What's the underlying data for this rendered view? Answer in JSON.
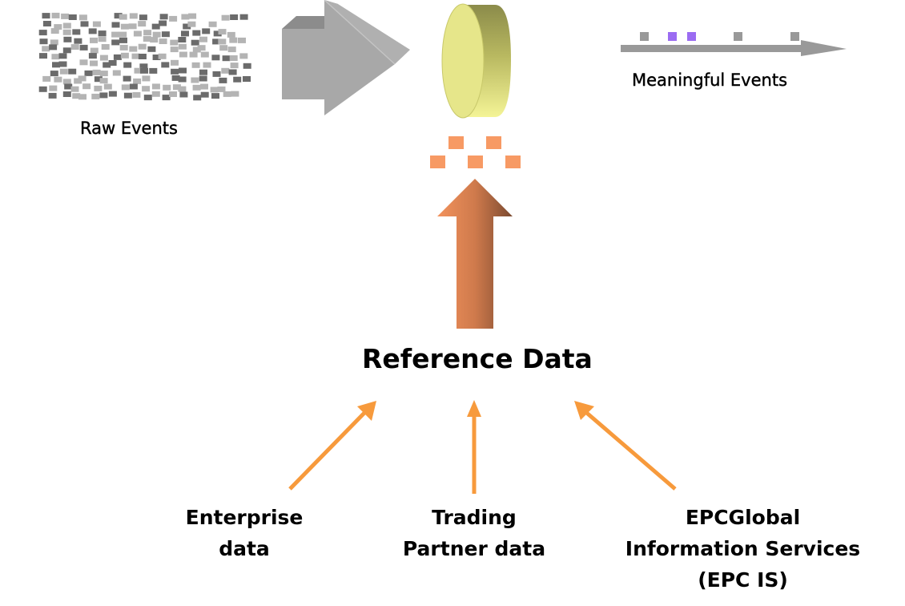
{
  "diagram": {
    "raw_events_label": "Raw Events",
    "meaningful_events_label": "Meaningful Events",
    "reference_data_label": "Reference Data",
    "sources": [
      {
        "line1": "Enterprise",
        "line2": "data",
        "line3": ""
      },
      {
        "line1": "Trading",
        "line2": "Partner data",
        "line3": ""
      },
      {
        "line1": "EPCGlobal",
        "line2": "Information Services",
        "line3": "(EPC IS)"
      }
    ],
    "colors": {
      "raw_event_dark": "#6b6b6b",
      "raw_event_light": "#b4b4b4",
      "process_arrow": "#a9a9a9",
      "filter_disc": "#e6e68a",
      "filter_disc_side": "#8d8d4a",
      "reference_squares": "#f79a64",
      "up_arrow_light": "#f08c58",
      "up_arrow_dark": "#7b4a30",
      "source_arrows": "#f79a3c",
      "timeline": "#999999",
      "event_gray": "#999999",
      "event_highlight": "#9b6cf2"
    },
    "icons": {
      "raw_events": "scattered-squares-icon",
      "process_arrow": "3d-arrow-right-icon",
      "filter": "disc-filter-icon",
      "timeline": "timeline-arrow-icon"
    }
  }
}
